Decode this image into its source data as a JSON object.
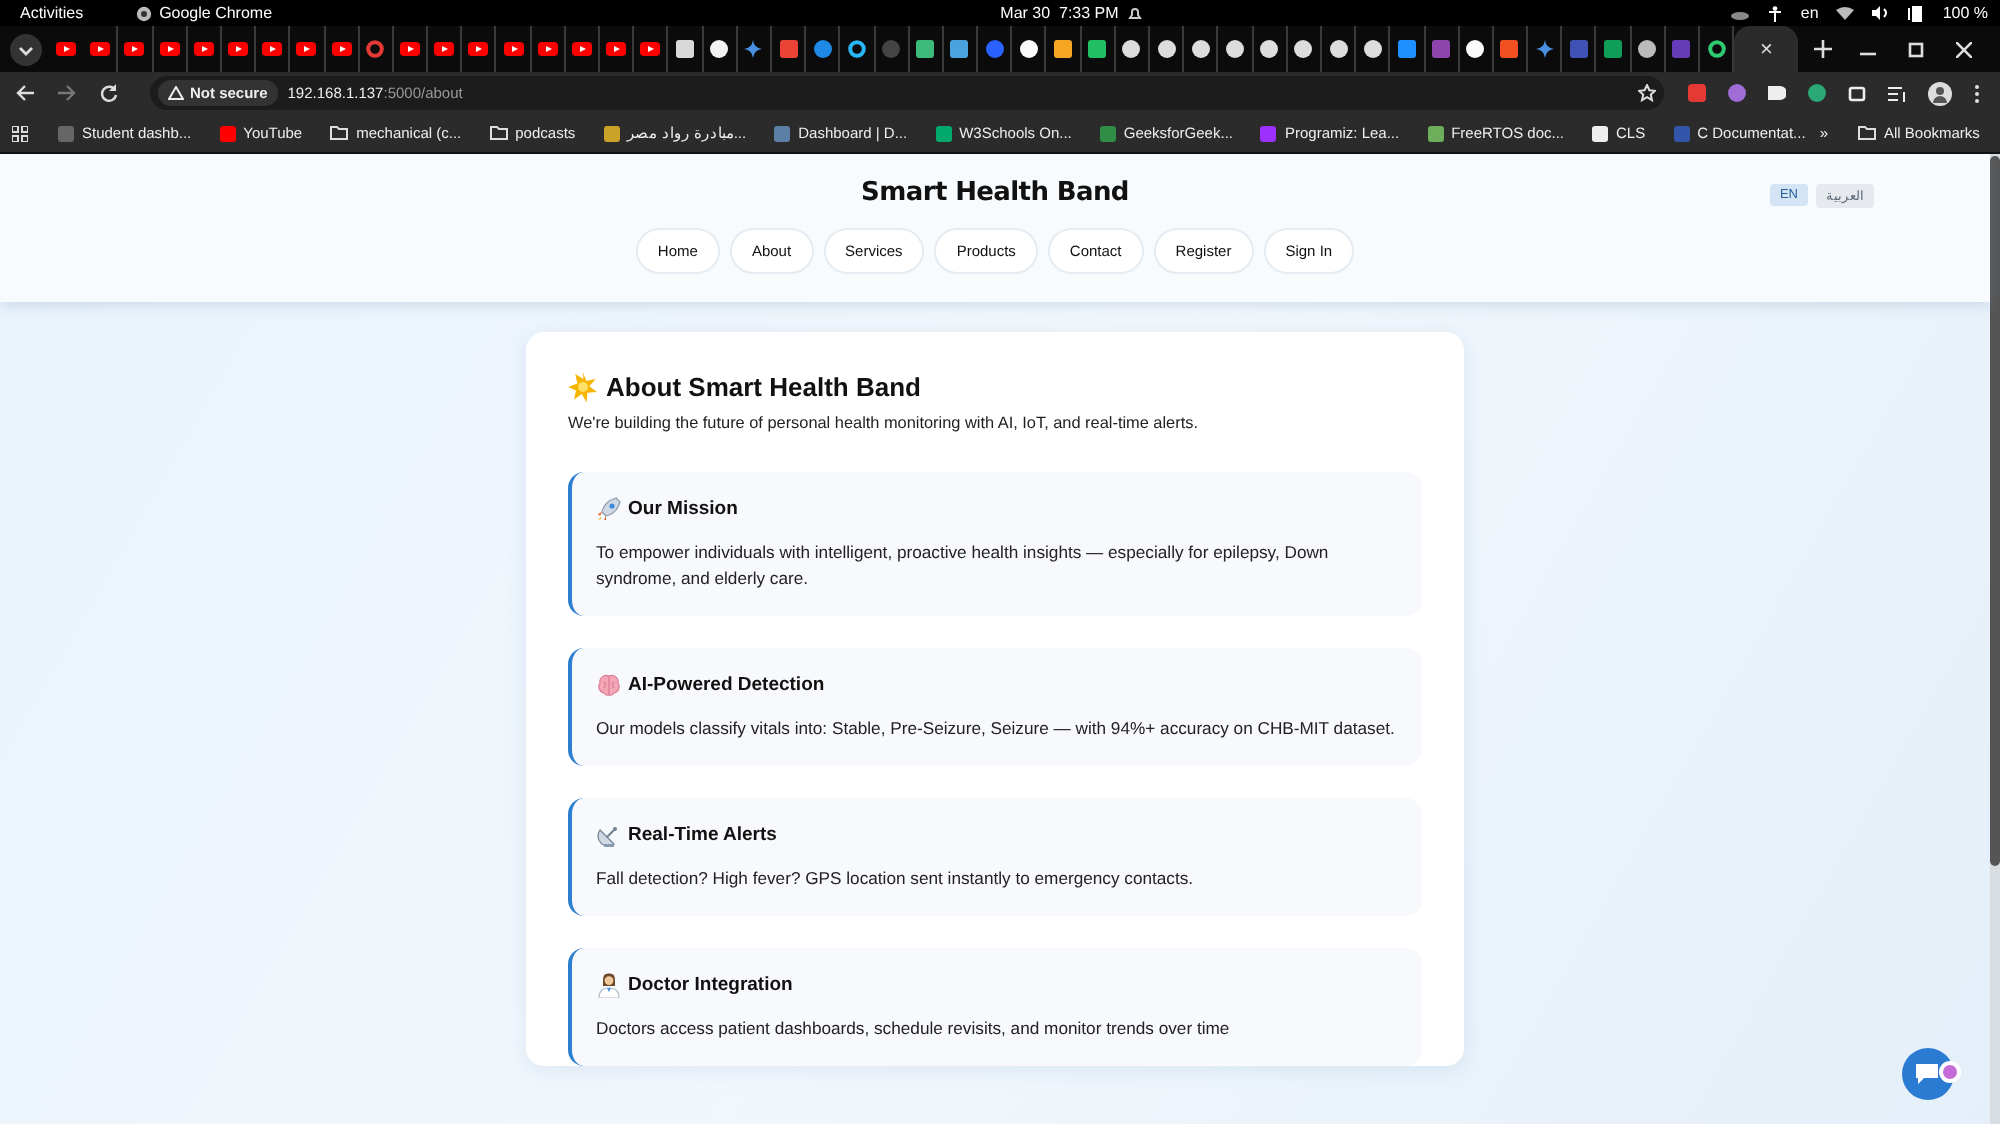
{
  "system_bar": {
    "activities": "Activities",
    "app": "Google Chrome",
    "clock": "Mar 30  7:33 PM",
    "language": "en",
    "battery": "100 %"
  },
  "tabs": [
    {
      "kind": "youtube",
      "selected": false
    },
    {
      "kind": "youtube",
      "selected": false
    },
    {
      "kind": "youtube",
      "selected": false
    },
    {
      "kind": "youtube",
      "selected": false
    },
    {
      "kind": "youtube",
      "selected": false
    },
    {
      "kind": "youtube",
      "selected": false
    },
    {
      "kind": "youtube",
      "selected": false
    },
    {
      "kind": "youtube",
      "selected": false
    },
    {
      "kind": "youtube",
      "selected": false
    },
    {
      "kind": "ring",
      "color": "#e53935",
      "selected": false
    },
    {
      "kind": "youtube",
      "selected": false
    },
    {
      "kind": "youtube",
      "selected": false
    },
    {
      "kind": "youtube",
      "selected": false
    },
    {
      "kind": "youtube",
      "selected": false
    },
    {
      "kind": "youtube",
      "selected": false
    },
    {
      "kind": "youtube",
      "selected": false
    },
    {
      "kind": "youtube",
      "selected": false
    },
    {
      "kind": "youtube",
      "selected": false
    },
    {
      "kind": "square",
      "color": "#d9d9d9",
      "selected": false
    },
    {
      "kind": "round",
      "color": "#f2f2f2",
      "selected": false
    },
    {
      "kind": "sparkle",
      "color": "#4a90e2",
      "selected": false
    },
    {
      "kind": "square",
      "color": "#ea4335",
      "selected": false
    },
    {
      "kind": "round",
      "color": "#1e88e5",
      "selected": false
    },
    {
      "kind": "ring",
      "color": "#29b6f6",
      "selected": false
    },
    {
      "kind": "round",
      "color": "#444444",
      "selected": false
    },
    {
      "kind": "square",
      "color": "#3dbb7a",
      "selected": false
    },
    {
      "kind": "square",
      "color": "#4aa3df",
      "selected": false
    },
    {
      "kind": "round",
      "color": "#2962ff",
      "selected": false
    },
    {
      "kind": "round",
      "color": "#fafafa",
      "selected": false
    },
    {
      "kind": "square",
      "color": "#f5a623",
      "selected": false
    },
    {
      "kind": "square",
      "color": "#21c064",
      "selected": false
    },
    {
      "kind": "round",
      "color": "#dddddd",
      "selected": false
    },
    {
      "kind": "round",
      "color": "#dddddd",
      "selected": false
    },
    {
      "kind": "round",
      "color": "#dddddd",
      "selected": false
    },
    {
      "kind": "round",
      "color": "#dddddd",
      "selected": false
    },
    {
      "kind": "round",
      "color": "#dddddd",
      "selected": false
    },
    {
      "kind": "round",
      "color": "#dddddd",
      "selected": false
    },
    {
      "kind": "round",
      "color": "#dddddd",
      "selected": false
    },
    {
      "kind": "round",
      "color": "#dddddd",
      "selected": false
    },
    {
      "kind": "square",
      "color": "#1e90ff",
      "selected": false
    },
    {
      "kind": "square",
      "color": "#8e44ad",
      "selected": false
    },
    {
      "kind": "round",
      "color": "#fbfbfb",
      "selected": false
    },
    {
      "kind": "square",
      "color": "#f25022",
      "selected": false
    },
    {
      "kind": "sparkle",
      "color": "#4a90e2",
      "selected": false
    },
    {
      "kind": "square",
      "color": "#3f51b5",
      "selected": false
    },
    {
      "kind": "square",
      "color": "#0f9d58",
      "selected": false
    },
    {
      "kind": "round",
      "color": "#bbbbbb",
      "selected": false
    },
    {
      "kind": "square",
      "color": "#673ab7",
      "selected": false
    },
    {
      "kind": "ring",
      "color": "#2ecc71",
      "selected": false
    },
    {
      "kind": "blank",
      "selected": true,
      "close": "×"
    }
  ],
  "address_bar": {
    "security": "Not secure",
    "host": "192.168.1.137",
    "path": ":5000/about"
  },
  "bookmarks": [
    {
      "kind": "site",
      "color": "#666666",
      "label": "Student dashb..."
    },
    {
      "kind": "site",
      "color": "#ff0000",
      "label": "YouTube"
    },
    {
      "kind": "folder",
      "label": "mechanical (c..."
    },
    {
      "kind": "folder",
      "label": "podcasts"
    },
    {
      "kind": "site",
      "color": "#c9a227",
      "label": "مبادرة رواد مصر..."
    },
    {
      "kind": "site",
      "color": "#5b7fa6",
      "label": "Dashboard | D..."
    },
    {
      "kind": "site",
      "color": "#04aa6d",
      "label": "W3Schools On..."
    },
    {
      "kind": "site",
      "color": "#2f8d46",
      "label": "GeeksforGeek..."
    },
    {
      "kind": "site",
      "color": "#9b30ff",
      "label": "Programiz: Lea..."
    },
    {
      "kind": "site",
      "color": "#6dae5a",
      "label": "FreeRTOS doc..."
    },
    {
      "kind": "site",
      "color": "#eeeeee",
      "label": "CLS"
    },
    {
      "kind": "site",
      "color": "#3355aa",
      "label": "C Documentat..."
    }
  ],
  "bookmarks_more": "»",
  "all_bookmarks": "All Bookmarks",
  "site": {
    "title": "Smart Health Band",
    "languages": [
      {
        "label": "EN",
        "selected": true
      },
      {
        "label": "العربية",
        "selected": false
      }
    ],
    "nav": [
      "Home",
      "About",
      "Services",
      "Products",
      "Contact",
      "Register",
      "Sign In"
    ]
  },
  "about": {
    "title": "About Smart Health Band",
    "subtitle": "We're building the future of personal health monitoring with AI, IoT, and real-time alerts.",
    "features": [
      {
        "kind": "rocket",
        "title": "Our Mission",
        "text": "To empower individuals with intelligent, proactive health insights — especially for epilepsy, Down syndrome, and elderly care."
      },
      {
        "kind": "brain",
        "title": "AI-Powered Detection",
        "text": "Our models classify vitals into: Stable, Pre-Seizure, Seizure — with 94%+ accuracy on CHB-MIT dataset."
      },
      {
        "kind": "satellite",
        "title": "Real-Time Alerts",
        "text": "Fall detection? High fever? GPS location sent instantly to emergency contacts."
      },
      {
        "kind": "doctor",
        "title": "Doctor Integration",
        "text": "Doctors access patient dashboards, schedule revisits, and monitor trends over time"
      }
    ]
  }
}
